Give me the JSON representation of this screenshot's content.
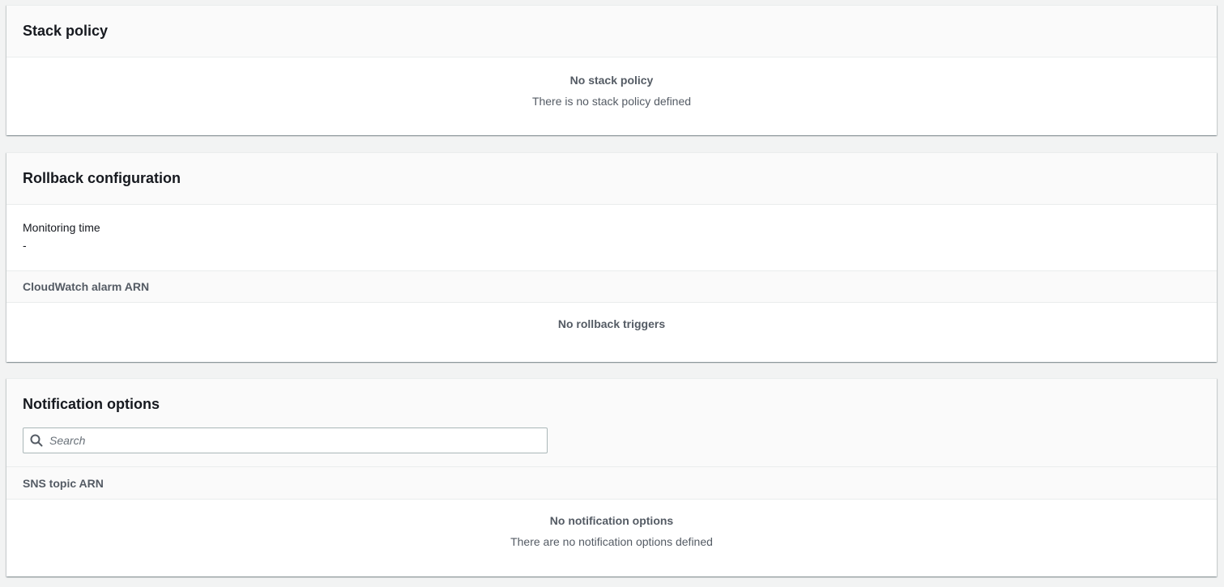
{
  "stack_policy": {
    "title": "Stack policy",
    "empty_title": "No stack policy",
    "empty_description": "There is no stack policy defined"
  },
  "rollback_configuration": {
    "title": "Rollback configuration",
    "monitoring_time_label": "Monitoring time",
    "monitoring_time_value": "-",
    "column_header": "CloudWatch alarm ARN",
    "empty_title": "No rollback triggers"
  },
  "notification_options": {
    "title": "Notification options",
    "search_placeholder": "Search",
    "search_value": "",
    "column_header": "SNS topic ARN",
    "empty_title": "No notification options",
    "empty_description": "There are no notification options defined"
  }
}
